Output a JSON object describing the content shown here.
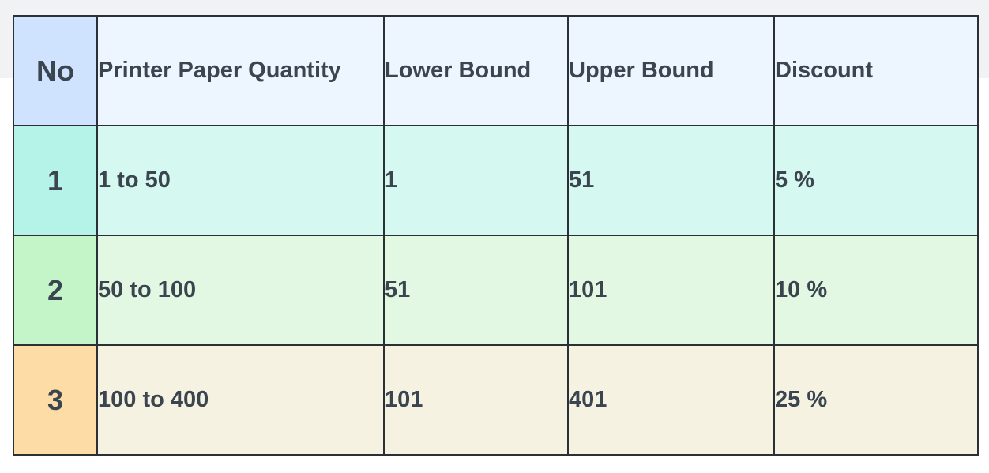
{
  "table": {
    "headers": [
      "No",
      "Printer Paper Quantity",
      "Lower Bound",
      "Upper Bound",
      "Discount"
    ],
    "rows": [
      {
        "no": "1",
        "quantity": "1 to 50",
        "lower": "1",
        "upper": "51",
        "discount": "5 %"
      },
      {
        "no": "2",
        "quantity": "50 to 100",
        "lower": "51",
        "upper": "101",
        "discount": "10 %"
      },
      {
        "no": "3",
        "quantity": "100 to 400",
        "lower": "101",
        "upper": "401",
        "discount": "25 %"
      }
    ]
  },
  "colors": {
    "header_no_bg": "#cfe3fe",
    "header_bg": "#edf5fe",
    "row1_no_bg": "#b5f3e8",
    "row1_bg": "#d5f8f1",
    "row2_no_bg": "#c4f5c9",
    "row2_bg": "#e2f8e3",
    "row3_no_bg": "#fedca5",
    "row3_bg": "#f6f2e2",
    "border": "#2b2f36",
    "text": "#3b4550",
    "page_top_band": "#f1f2f4"
  }
}
